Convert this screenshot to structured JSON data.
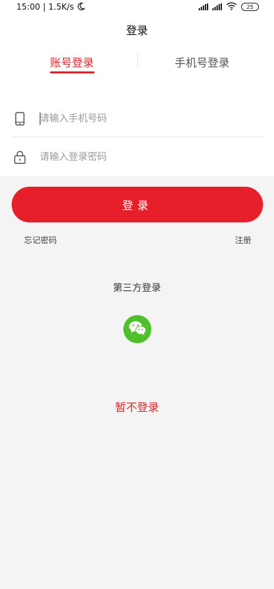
{
  "status_bar": {
    "time": "15:00",
    "speed": "1.5K/s",
    "battery": "25"
  },
  "header": {
    "title": "登录"
  },
  "tabs": [
    {
      "label": "账号登录",
      "active": true
    },
    {
      "label": "手机号登录",
      "active": false
    }
  ],
  "form": {
    "phone_placeholder": "请输入手机号码",
    "password_placeholder": "请输入登录密码"
  },
  "actions": {
    "login_label": "登录",
    "forgot_label": "忘记密码",
    "register_label": "注册"
  },
  "third_party": {
    "title": "第三方登录",
    "provider_icon": "wechat-icon"
  },
  "skip_label": "暂不登录",
  "colors": {
    "accent": "#d8262c",
    "button": "#e61f2a",
    "wechat": "#4fbf2a",
    "background": "#f4f4f4"
  }
}
